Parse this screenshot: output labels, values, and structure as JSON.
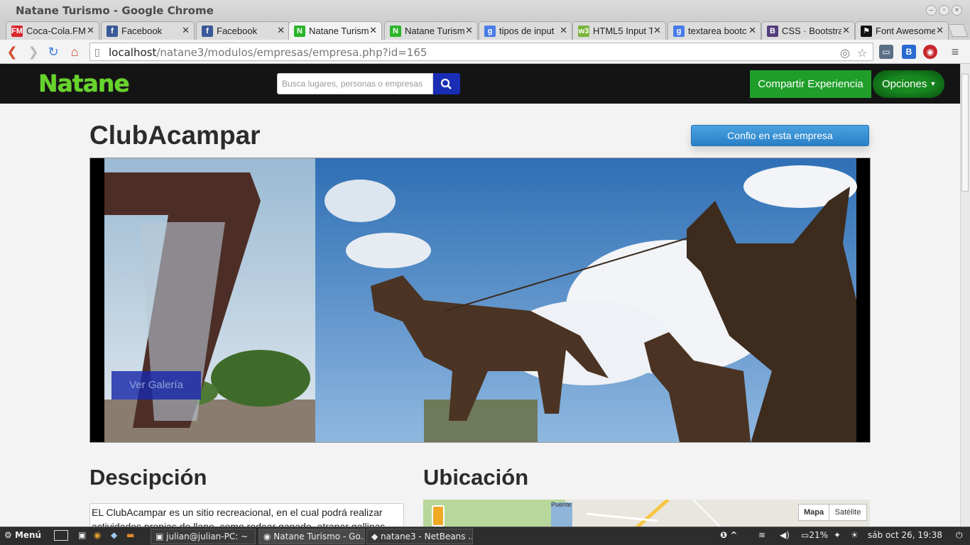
{
  "window": {
    "title": "Natane Turismo - Google Chrome"
  },
  "tabs": [
    {
      "label": "Coca-Cola.FM C",
      "favicon": "cocacola-icon",
      "color": "#d7262c",
      "glyph": "FM"
    },
    {
      "label": "Facebook",
      "favicon": "facebook-icon",
      "color": "#3b5998",
      "glyph": "f"
    },
    {
      "label": "Facebook",
      "favicon": "facebook-icon",
      "color": "#3b5998",
      "glyph": "f"
    },
    {
      "label": "Natane Turism",
      "favicon": "natane-icon",
      "color": "#2bb52b",
      "glyph": "N",
      "active": true
    },
    {
      "label": "Natane Turism",
      "favicon": "natane-icon",
      "color": "#2bb52b",
      "glyph": "N"
    },
    {
      "label": "tipos de input",
      "favicon": "google-icon",
      "color": "#4a7ce8",
      "glyph": "g"
    },
    {
      "label": "HTML5 Input T",
      "favicon": "w3-icon",
      "color": "#7ab53a",
      "glyph": "w3"
    },
    {
      "label": "textarea bootc",
      "favicon": "google-icon",
      "color": "#4a7ce8",
      "glyph": "g"
    },
    {
      "label": "CSS · Bootstrap",
      "favicon": "bootstrap-icon",
      "color": "#563d7c",
      "glyph": "B"
    },
    {
      "label": "Font Awesome",
      "favicon": "fontawesome-icon",
      "color": "#111111",
      "glyph": "⚑"
    }
  ],
  "address_bar": {
    "host": "localhost",
    "path": "/natane3/modulos/empresas/empresa.php?id=165"
  },
  "site": {
    "logo": "Natane",
    "search_placeholder": "Busca lugares, personas o empresas",
    "share_label": "Compartir Experiencia",
    "options_label": "Opciones",
    "accent_green": "#1f9e2a",
    "accent_blue": "#1a2db5"
  },
  "company": {
    "name": "ClubAcampar",
    "trust_label": "Confio en esta empresa",
    "gallery_label": "Ver Galería",
    "description_heading": "Descipción",
    "location_heading": "Ubicación",
    "description": "EL ClubAcampar es un sitio recreacional, en el cual podrá realizar actividades propias de llano, como rodear ganado, atrapar gallinas",
    "map": {
      "label_puente": "Puente",
      "mapa": "Mapa",
      "satelite": "Satélite"
    }
  },
  "taskbar": {
    "menu": "Menú",
    "tasks": [
      "julian@julian-PC: ~",
      "Natane Turismo - Go...",
      "natane3 - NetBeans ..."
    ],
    "notifications": "1",
    "battery": "21%",
    "clock": "sáb oct 26, 19:38"
  }
}
